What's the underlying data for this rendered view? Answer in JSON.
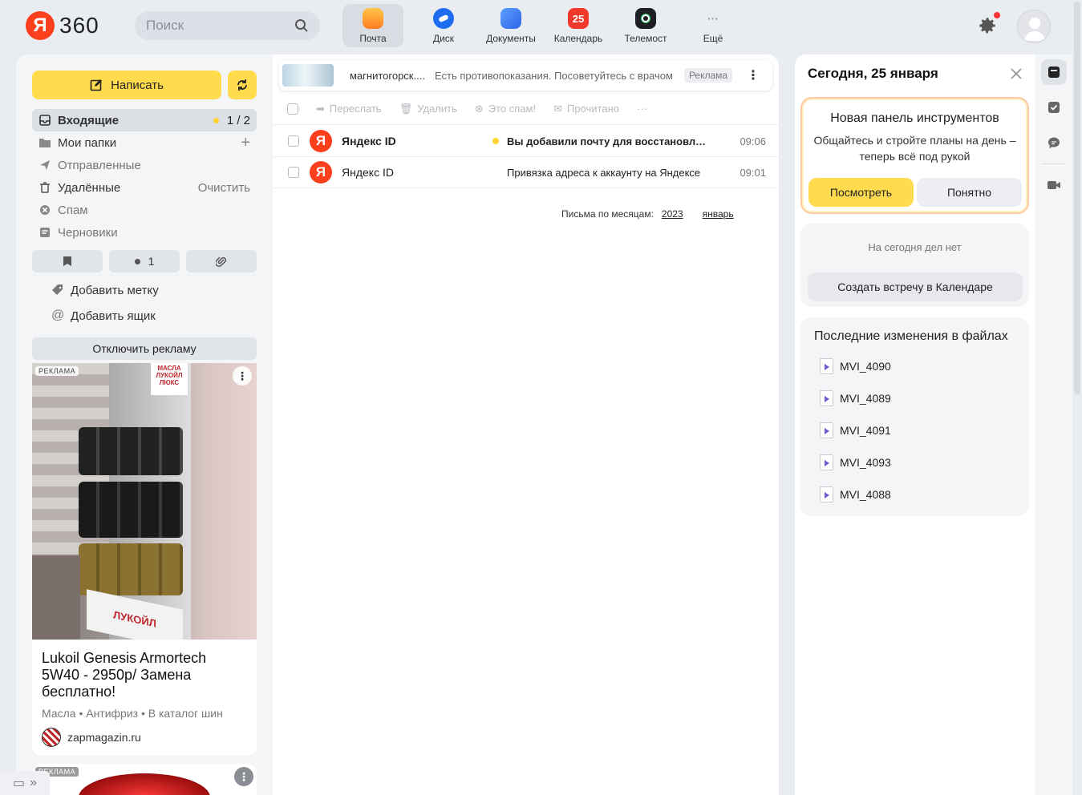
{
  "header": {
    "logo_ya": "Я",
    "logo_360": "360",
    "search_placeholder": "Поиск",
    "apps": [
      {
        "label": "Почта",
        "badge": ""
      },
      {
        "label": "Диск",
        "badge": ""
      },
      {
        "label": "Документы",
        "badge": ""
      },
      {
        "label": "Календарь",
        "badge": "25"
      },
      {
        "label": "Телемост",
        "badge": ""
      },
      {
        "label": "Ещё",
        "badge": "···"
      }
    ]
  },
  "sidebar": {
    "compose_label": "Написать",
    "folders": [
      {
        "label": "Входящие",
        "count": "1 / 2"
      },
      {
        "label": "Мои папки",
        "action": "+"
      },
      {
        "label": "Отправленные"
      },
      {
        "label": "Удалённые",
        "action": "Очистить"
      },
      {
        "label": "Спам"
      },
      {
        "label": "Черновики"
      }
    ],
    "filters": {
      "unread_count": "1"
    },
    "add_label": "Добавить метку",
    "add_mailbox": "Добавить ящик",
    "disable_ads": "Отключить рекламу",
    "ad": {
      "badge": "РЕКЛАМА",
      "title": "Lukoil Genesis Armortech 5W40 - 2950р/ Замена бесплатно!",
      "meta": "Масла • Антифриз • В каталог шин",
      "site": "zapmagazin.ru",
      "image_text_top": "МАСЛА ЛУКОЙЛ ЛЮКС",
      "image_text_bottom": "ЛУКОЙЛ"
    },
    "ad2_badge": "РЕКЛАМА"
  },
  "mail": {
    "ad_banner": {
      "source": "магнитогорск....",
      "text": "Есть противопоказания. Посоветуйтесь с врачом",
      "label": "Реклама"
    },
    "toolbar": [
      "Переслать",
      "Удалить",
      "Это спам!",
      "Прочитано",
      "···"
    ],
    "rows": [
      {
        "sender": "Яндекс ID",
        "subject": "Вы добавили почту для восстановления",
        "time": "09:06",
        "unread": true
      },
      {
        "sender": "Яндекс ID",
        "subject": "Привязка адреса к аккаунту на Яндексе",
        "time": "09:01",
        "unread": false
      }
    ],
    "months_label": "Письма по месяцам:",
    "year": "2023",
    "month": "январь"
  },
  "right_panel": {
    "title": "Сегодня, 25 января",
    "promo_title": "Новая панель инструментов",
    "promo_text": "Общайтесь и стройте планы на день – теперь всё под рукой",
    "btn_view": "Посмотреть",
    "btn_ok": "Понятно",
    "today_empty": "На сегодня дел нет",
    "create_meeting": "Создать встречу в Календаре",
    "files_title": "Последние изменения в файлах",
    "files": [
      "MVI_4090",
      "MVI_4089",
      "MVI_4091",
      "MVI_4093",
      "MVI_4088"
    ]
  },
  "colors": {
    "accent": "#ffdb4d",
    "brand": "#fc3f1d",
    "unread_dot": "#ffd433"
  }
}
